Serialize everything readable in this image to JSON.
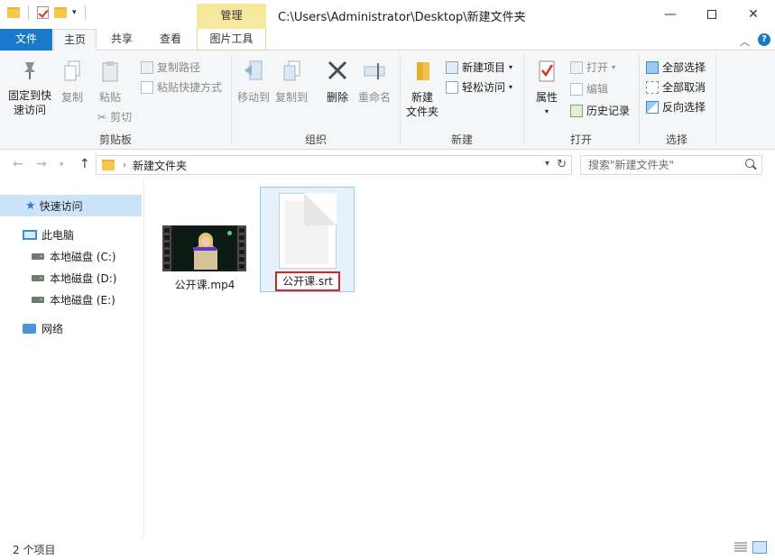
{
  "window": {
    "title_path": "C:\\Users\\Administrator\\Desktop\\新建文件夹",
    "manage_tab": "管理",
    "controls": {
      "minimize": "—",
      "close": "✕"
    }
  },
  "tabs": {
    "file": "文件",
    "home": "主页",
    "share": "共享",
    "view": "查看",
    "picture_tools": "图片工具"
  },
  "ribbon": {
    "clipboard": {
      "label": "剪贴板",
      "pin": [
        "固定到快",
        "速访问"
      ],
      "copy": "复制",
      "paste": "粘贴",
      "copy_path": "复制路径",
      "paste_shortcut": "粘贴快捷方式",
      "cut": "剪切"
    },
    "organize": {
      "label": "组织",
      "move_to": "移动到",
      "copy_to": "复制到",
      "delete": "删除",
      "rename": "重命名"
    },
    "new": {
      "label": "新建",
      "new_folder": [
        "新建",
        "文件夹"
      ],
      "new_item": "新建项目",
      "easy_access": "轻松访问"
    },
    "open": {
      "label": "打开",
      "properties": "属性",
      "open": "打开",
      "edit": "编辑",
      "history": "历史记录"
    },
    "select": {
      "label": "选择",
      "select_all": "全部选择",
      "select_none": "全部取消",
      "invert": "反向选择"
    }
  },
  "address": {
    "current_folder": "新建文件夹",
    "search_placeholder": "搜索\"新建文件夹\""
  },
  "nav": {
    "quick_access": "快速访问",
    "this_pc": "此电脑",
    "drive_c": "本地磁盘 (C:)",
    "drive_d": "本地磁盘 (D:)",
    "drive_e": "本地磁盘 (E:)",
    "network": "网络"
  },
  "files": [
    {
      "name": "公开课.mp4"
    },
    {
      "name": "公开课.srt"
    }
  ],
  "status": {
    "count": "2 个项目"
  }
}
